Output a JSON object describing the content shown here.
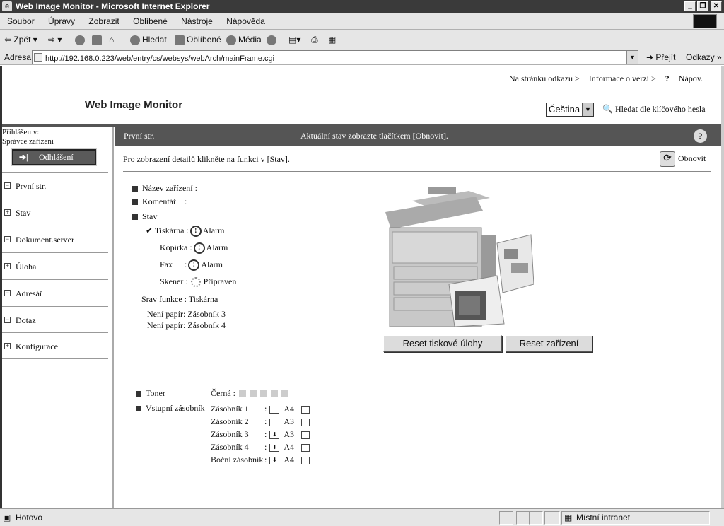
{
  "window": {
    "title": "Web Image Monitor - Microsoft Internet Explorer",
    "min": "_",
    "max": "❐",
    "close": "✕"
  },
  "menu": [
    "Soubor",
    "Úpravy",
    "Zobrazit",
    "Oblíbené",
    "Nástroje",
    "Nápověda"
  ],
  "toolbar": {
    "back": "Zpět",
    "search": "Hledat",
    "favorites": "Oblíbené",
    "media": "Média"
  },
  "address": {
    "label": "Adresa",
    "url": "http://192.168.0.223/web/entry/cs/websys/webArch/mainFrame.cgi",
    "go": "Přejít",
    "links": "Odkazy"
  },
  "header": {
    "link_page": "Na stránku odkazu >",
    "link_version": "Informace o verzi >",
    "help": "Nápov.",
    "brand": "Web Image Monitor",
    "language": "Čeština",
    "keyword_search": "Hledat dle klíčového hesla"
  },
  "sidebar": {
    "logged_in_as": "Přihlášen v:",
    "user": "Správce zařízení",
    "logout": "Odhlášení",
    "items": [
      {
        "label": "První str.",
        "icon": "−"
      },
      {
        "label": "Stav",
        "icon": "+"
      },
      {
        "label": "Dokument.server",
        "icon": "−"
      },
      {
        "label": "Úloha",
        "icon": "+"
      },
      {
        "label": "Adresář",
        "icon": "−"
      },
      {
        "label": "Dotaz",
        "icon": "−"
      },
      {
        "label": "Konfigurace",
        "icon": "+"
      }
    ]
  },
  "infobar": {
    "page": "První str.",
    "message": "Aktuální stav zobrazte tlačítkem [Obnovit]."
  },
  "main": {
    "detail_hint": "Pro zobrazení detailů klikněte na funkci v [Stav].",
    "refresh": "Obnovit",
    "device_name_label": "Název zařízení",
    "comment_label": "Komentář",
    "status_label": "Stav",
    "functions": [
      {
        "name": "Tiskárna",
        "status": "Alarm"
      },
      {
        "name": "Kopírka",
        "status": "Alarm"
      },
      {
        "name": "Fax",
        "status": "Alarm"
      },
      {
        "name": "Skener",
        "status": "Připraven"
      }
    ],
    "function_state_label": "Srav funkce : Tiskárna",
    "messages": [
      "Není papír: Zásobník 3",
      "Není papír: Zásobník 4"
    ],
    "reset_job": "Reset tiskové úlohy",
    "reset_device": "Reset zařízení",
    "toner_label": "Toner",
    "toner_color": "Černá :",
    "trays_label": "Vstupní zásobník",
    "trays": [
      {
        "name": "Zásobník 1",
        "size": "A4"
      },
      {
        "name": "Zásobník 2",
        "size": "A3"
      },
      {
        "name": "Zásobník 3",
        "size": "A3"
      },
      {
        "name": "Zásobník 4",
        "size": "A4"
      },
      {
        "name": "Boční zásobník",
        "size": "A4"
      }
    ]
  },
  "statusbar": {
    "text": "Hotovo",
    "zone": "Místní intranet"
  }
}
